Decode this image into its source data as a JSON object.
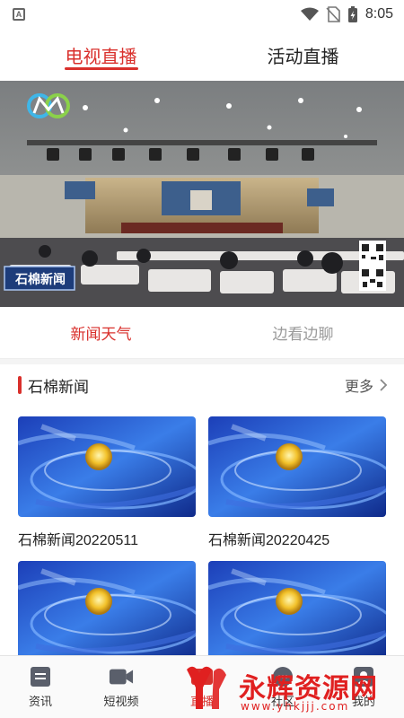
{
  "status_bar": {
    "time": "8:05",
    "icons": [
      "notification-a-icon",
      "wifi-icon",
      "no-sim-icon",
      "battery-charging-icon"
    ]
  },
  "top_tabs": [
    {
      "label": "电视直播",
      "active": true
    },
    {
      "label": "活动直播",
      "active": false
    }
  ],
  "video": {
    "channel_caption": "石棉新闻"
  },
  "sub_tabs": [
    {
      "label": "新闻天气",
      "active": true
    },
    {
      "label": "边看边聊",
      "active": false
    }
  ],
  "section": {
    "title": "石棉新闻",
    "more_label": "更多"
  },
  "news_items": [
    {
      "title": "石棉新闻20220511"
    },
    {
      "title": "石棉新闻20220425"
    },
    {
      "title": ""
    },
    {
      "title": ""
    }
  ],
  "bottom_nav": [
    {
      "label": "资讯",
      "icon": "news-icon"
    },
    {
      "label": "短视频",
      "icon": "video-camera-icon"
    },
    {
      "label": "直播",
      "icon": "live-icon"
    },
    {
      "label": "社区",
      "icon": "community-icon"
    },
    {
      "label": "我的",
      "icon": "profile-icon"
    }
  ],
  "watermark": {
    "text": "永辉资源网",
    "url_text": "www.yhkjjj.com"
  },
  "colors": {
    "accent": "#d9302c",
    "inactive_tab": "#999999"
  }
}
